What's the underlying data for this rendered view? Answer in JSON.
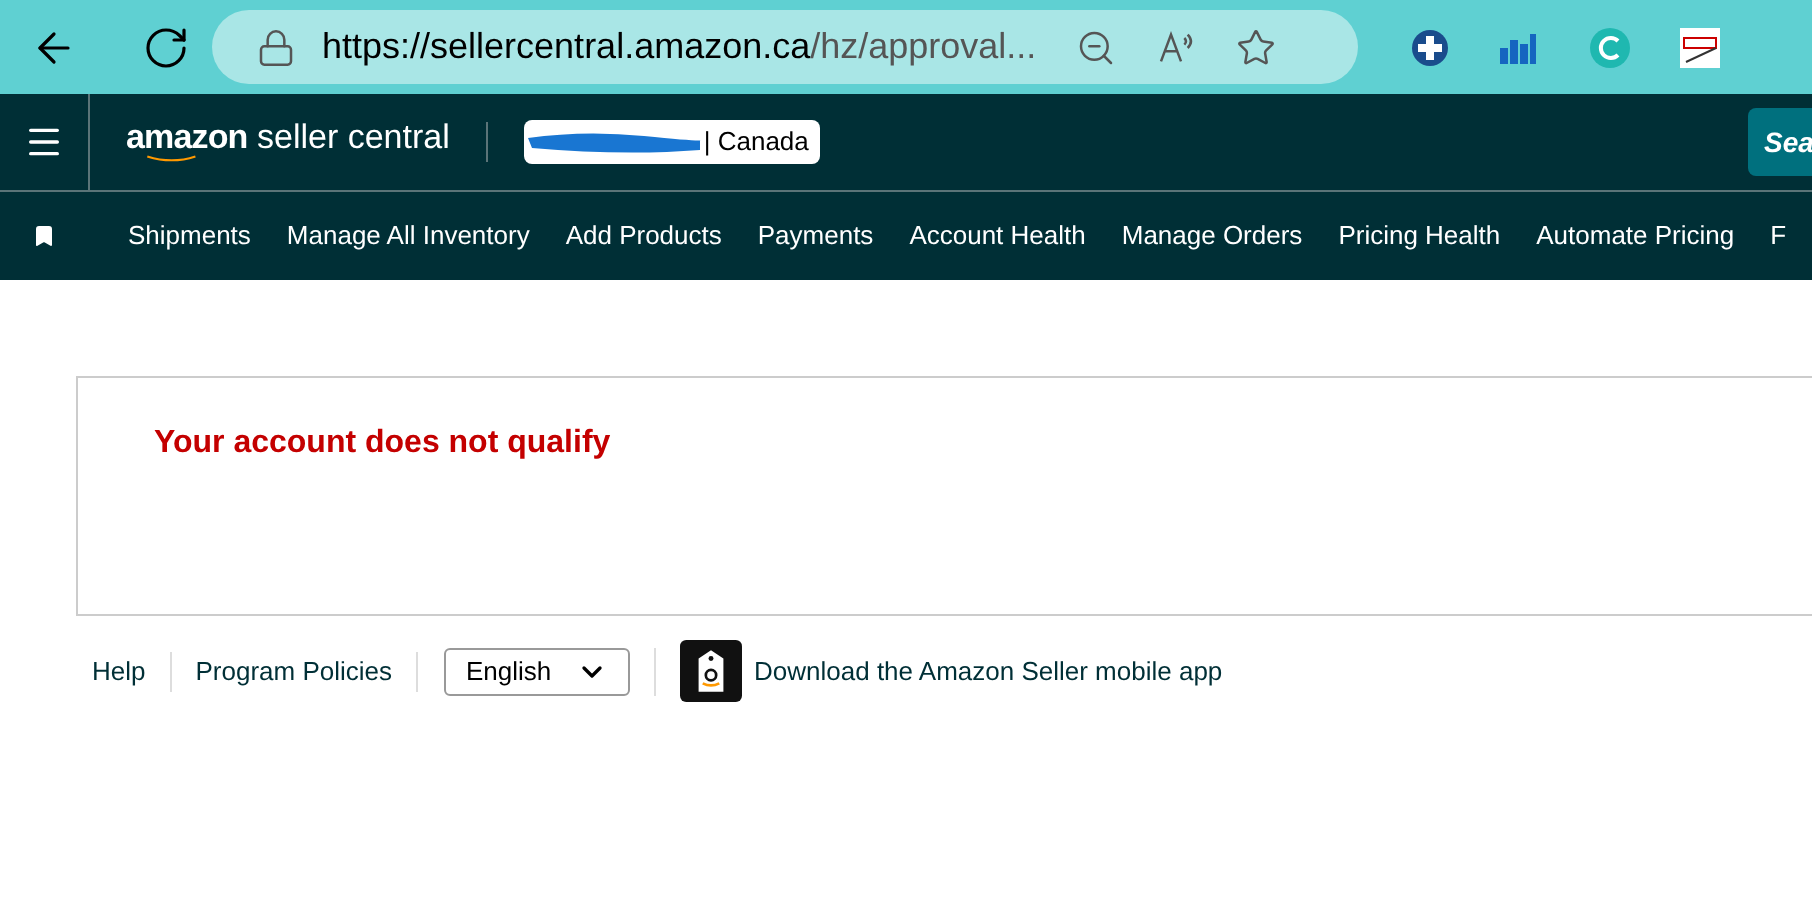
{
  "browser": {
    "url_host": "https://sellercentral.amazon.ca",
    "url_path": "/hz/approval..."
  },
  "header": {
    "logo_brand": "amazon",
    "logo_product": "seller central",
    "marketplace": "| Canada",
    "search_button": "Sea"
  },
  "nav": {
    "items": [
      "Shipments",
      "Manage All Inventory",
      "Add Products",
      "Payments",
      "Account Health",
      "Manage Orders",
      "Pricing Health",
      "Automate Pricing",
      "F"
    ]
  },
  "message": "Your account does not qualify",
  "footer": {
    "links": [
      "Help",
      "Program Policies"
    ],
    "language": "English",
    "app_link": "Download the Amazon Seller mobile app"
  }
}
